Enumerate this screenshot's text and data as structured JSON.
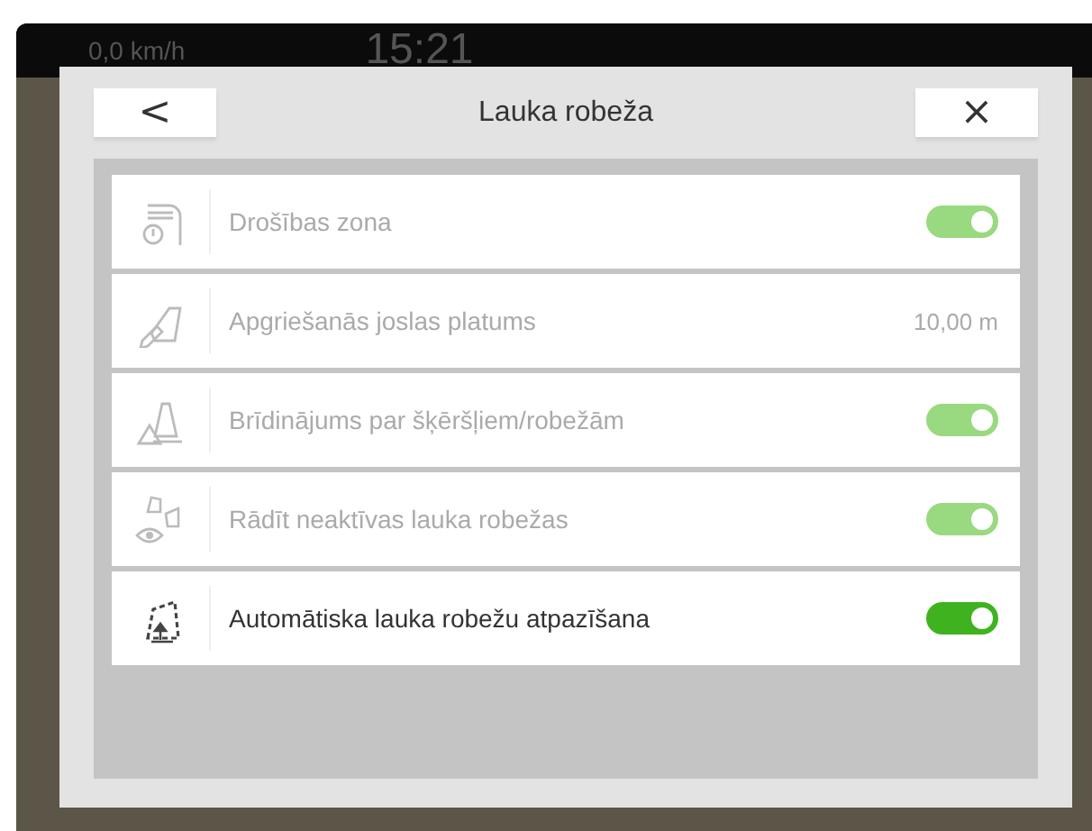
{
  "status_bar": {
    "speed": "0,0 km/h",
    "time": "15:21"
  },
  "dialog": {
    "title": "Lauka robeža",
    "back_label": "<",
    "close_label": "×",
    "rows": [
      {
        "kind": "toggle",
        "label": "Drošības zona",
        "disabled": true,
        "on": true
      },
      {
        "kind": "value",
        "label": "Apgriešanās joslas platums",
        "value": "10,00 m",
        "disabled": true
      },
      {
        "kind": "toggle",
        "label": "Brīdinājums par šķēršļiem/robežām",
        "disabled": true,
        "on": true
      },
      {
        "kind": "toggle",
        "label": "Rādīt neaktīvas lauka robežas",
        "disabled": true,
        "on": true
      },
      {
        "kind": "toggle",
        "label": "Automātiska lauka robežu atpazīšana",
        "disabled": false,
        "on": true
      }
    ]
  }
}
